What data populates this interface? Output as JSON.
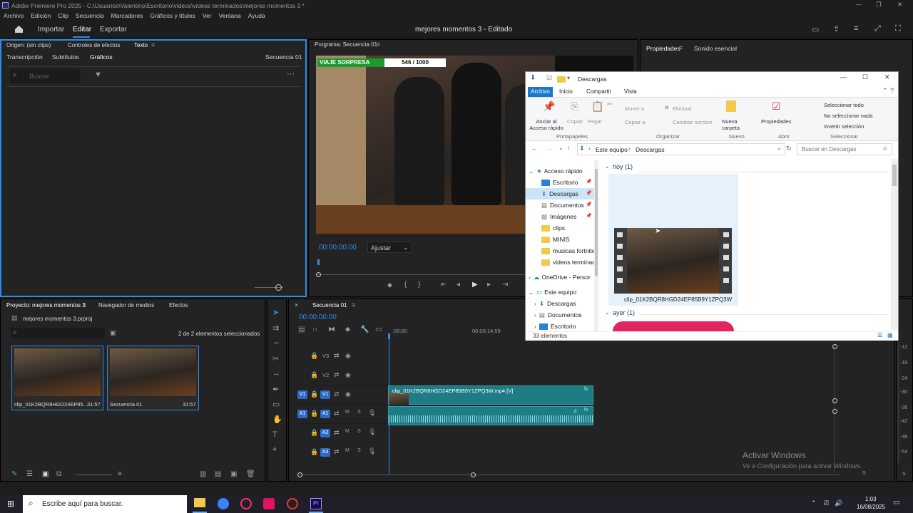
{
  "window": {
    "app_title": "Adobe Premiere Pro 2025 - C:\\Usuarios\\Valentino\\Escritorio\\videos\\videos terminados\\mejores momentos 3 *"
  },
  "menu": [
    "Archivo",
    "Edición",
    "Clip",
    "Secuencia",
    "Marcadores",
    "Gráficos y títulos",
    "Ver",
    "Ventana",
    "Ayuda"
  ],
  "header": {
    "tabs": [
      "Importar",
      "Editar",
      "Exportar"
    ],
    "project_title": "mejores momentos 3 - Editado"
  },
  "left_panel": {
    "tabs_top": [
      "Origen: (sin clips)",
      "Controles de efectos",
      "Texto"
    ],
    "tabs_sub": [
      "Transcripción",
      "Subtítulos",
      "Gráficos"
    ],
    "sequence": "Secuencia 01",
    "search_placeholder": "Buscar"
  },
  "program": {
    "title": "Programa: Secuencia 01",
    "overlay_left": "VIAJE SORPRESA",
    "overlay_right": "546 / 1000",
    "timecode": "00:00:00:00",
    "zoom": "Ajustar"
  },
  "right_panel": {
    "tabs": [
      "Propiedades",
      "Sonido esencial"
    ]
  },
  "project_panel": {
    "tabs": [
      "Proyecto: mejores momentos 3",
      "Navegador de medios",
      "Efectos"
    ],
    "file": "mejores momentos 3.prproj",
    "selected": "2 de 2 elementos seleccionados",
    "items": [
      {
        "name": "clip_01K2BQR8HGD24EP85...",
        "dur": "31:57"
      },
      {
        "name": "Secuencia 01",
        "dur": "31:57"
      }
    ]
  },
  "timeline": {
    "title": "Secuencia 01",
    "timecode": "00:00:00:00",
    "ruler": [
      ":00:00",
      "00:00:14:59"
    ],
    "tracks": [
      "V3",
      "V2",
      "V1",
      "A1",
      "A2",
      "A3"
    ],
    "video_clip": "clip_01K2BQR8HGD24EP85B9Y1ZPQ3W.mp4 [V]",
    "meter": [
      "-12",
      "-18",
      "-24",
      "-30",
      "-36",
      "-42",
      "-48",
      "-54",
      "S",
      "S"
    ]
  },
  "explorer": {
    "title": "Descargas",
    "ribbon_tabs": [
      "Archivo",
      "Inicio",
      "Compartir",
      "Vista"
    ],
    "pin": "Anclar al Acceso rápido",
    "copy": "Copiar",
    "paste": "Pegar",
    "group1": "Portapapeles",
    "move": "Mover a",
    "copyto": "Copiar a",
    "delete": "Eliminar",
    "rename": "Cambiar nombre",
    "group2": "Organizar",
    "newfolder": "Nueva carpeta",
    "group3": "Nuevo",
    "props": "Propiedades",
    "group4": "Abrir",
    "selall": "Seleccionar todo",
    "selnone": "No seleccionar nada",
    "invert": "Invertir selección",
    "group5": "Seleccionar",
    "crumb": [
      "Este equipo",
      "Descargas"
    ],
    "search_placeholder": "Buscar en Descargas",
    "tree": [
      "Acceso rápido",
      "Escritorio",
      "Descargas",
      "Documentos",
      "Imágenes",
      "clips",
      "MINIS",
      "musicas fortnite",
      "videos terminad",
      "OneDrive - Persor",
      "Este equipo",
      "Descargas",
      "Documentos",
      "Escritorio"
    ],
    "group_today": "hoy (1)",
    "group_yesterday": "ayer (1)",
    "file": "clip_01K2BQR8HGD24EP85B9Y1ZPQ3W",
    "count": "33 elementos"
  },
  "watermark": {
    "line1": "Activar Windows",
    "line2": "Ve a Configuración para activar Windows."
  },
  "taskbar": {
    "search": "Escribe aquí para buscar.",
    "time": "1:03",
    "date": "16/08/2025"
  }
}
